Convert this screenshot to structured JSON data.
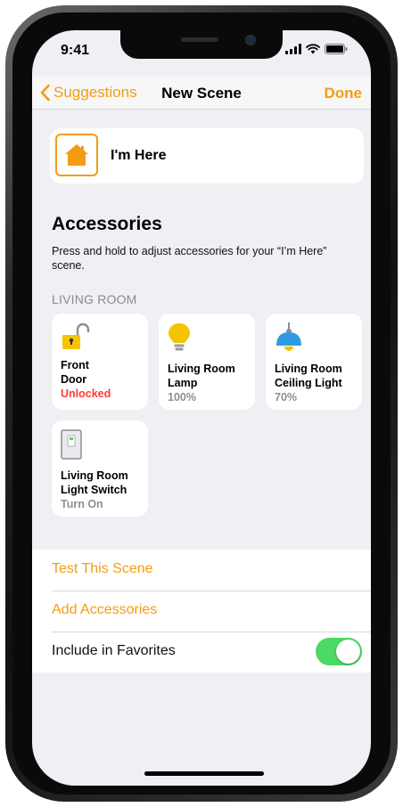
{
  "status_bar": {
    "time": "9:41"
  },
  "nav": {
    "back_label": "Suggestions",
    "title": "New Scene",
    "done_label": "Done"
  },
  "scene": {
    "name": "I'm Here"
  },
  "accessories": {
    "title": "Accessories",
    "description": "Press and hold to adjust accessories for your “I’m Here” scene.",
    "room_label": "LIVING ROOM",
    "tiles": [
      {
        "name_line1": "Front",
        "name_line2": "Door",
        "state": "Unlocked",
        "icon": "unlocked-lock-icon"
      },
      {
        "name_line1": "Living Room",
        "name_line2": "Lamp",
        "state": "100%",
        "icon": "light-bulb-icon"
      },
      {
        "name_line1": "Living Room",
        "name_line2": "Ceiling Light",
        "state": "70%",
        "icon": "ceiling-light-icon"
      },
      {
        "name_line1": "Living Room",
        "name_line2": "Light Switch",
        "state": "Turn On",
        "icon": "light-switch-icon"
      }
    ]
  },
  "actions": {
    "test_scene": "Test This Scene",
    "add_accessories": "Add Accessories",
    "include_favorites": "Include in Favorites",
    "favorites_on": true
  },
  "colors": {
    "accent": "#f39c12",
    "toggle_on": "#4cd964",
    "unlocked": "#ff3b30"
  }
}
